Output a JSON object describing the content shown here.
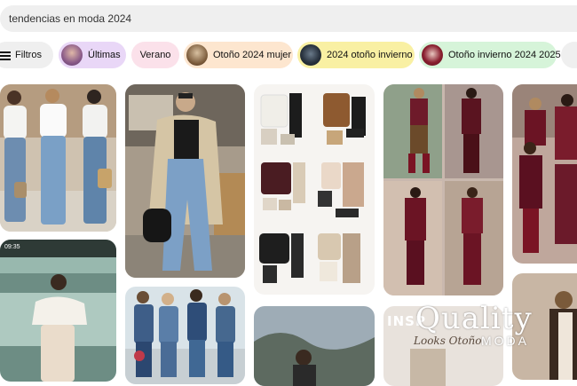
{
  "search": {
    "value": "tendencias en moda 2024"
  },
  "chips": [
    {
      "label": "Filtros",
      "bg": "#efefef"
    },
    {
      "label": "Últimas",
      "bg": "#e9d7f7"
    },
    {
      "label": "Verano",
      "bg": "#fbe1ea"
    },
    {
      "label": "Otoño 2024 mujer",
      "bg": "#fde6cf"
    },
    {
      "label": "2024 otoño invierno",
      "bg": "#f9f0a3"
    },
    {
      "label": "Otoño invierno 2024 2025",
      "bg": "#d6f4d9"
    }
  ],
  "pins": {
    "partial_caption": "INSP",
    "looks_caption": "Looks Otoño"
  },
  "watermark": {
    "brand": "Quality",
    "sub": "MODA"
  }
}
